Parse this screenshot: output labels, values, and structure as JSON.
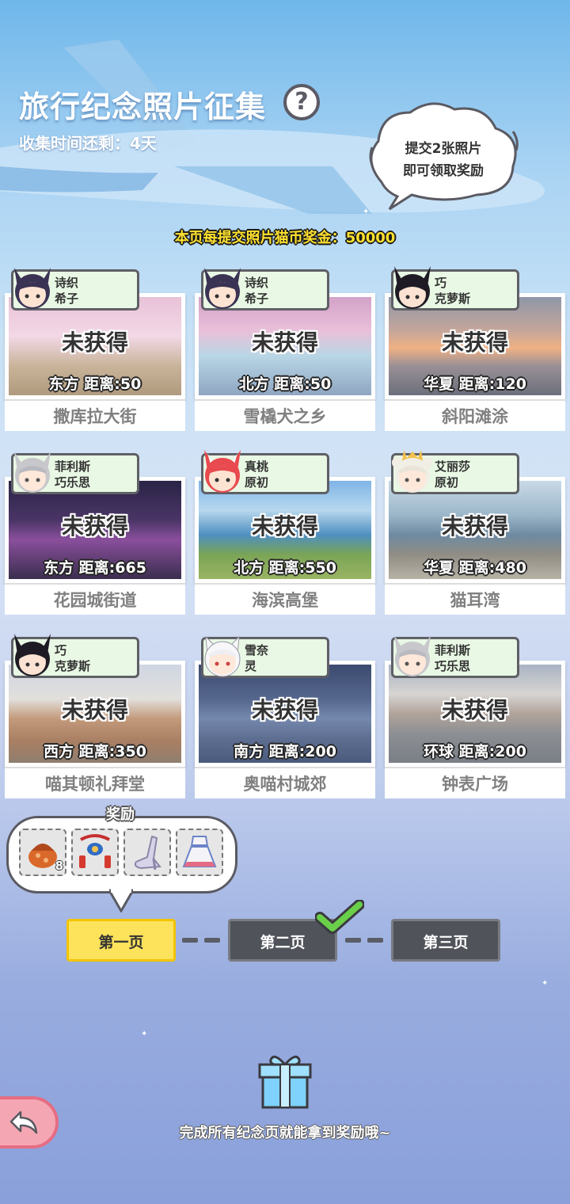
{
  "header": {
    "title": "旅行纪念照片征集",
    "help_symbol": "?",
    "remaining": "收集时间还剩：4天"
  },
  "hint_cloud": {
    "line1": "提交2张照片",
    "line2": "即可领取奖励"
  },
  "bonus_text": "本页每提交照片猫币奖金：50000",
  "cards": [
    {
      "char_line1": "诗织",
      "char_line2": "希子",
      "status": "未获得",
      "distance": "东方  距离:50",
      "place": "撒库拉大街"
    },
    {
      "char_line1": "诗织",
      "char_line2": "希子",
      "status": "未获得",
      "distance": "北方  距离:50",
      "place": "雪橇犬之乡"
    },
    {
      "char_line1": "巧",
      "char_line2": "克萝斯",
      "status": "未获得",
      "distance": "华夏  距离:120",
      "place": "斜阳滩涂"
    },
    {
      "char_line1": "菲利斯",
      "char_line2": "巧乐思",
      "status": "未获得",
      "distance": "东方  距离:665",
      "place": "花园城街道"
    },
    {
      "char_line1": "真桃",
      "char_line2": "原初",
      "status": "未获得",
      "distance": "北方  距离:550",
      "place": "海滨高堡"
    },
    {
      "char_line1": "艾丽莎",
      "char_line2": "原初",
      "status": "未获得",
      "distance": "华夏  距离:480",
      "place": "猫耳湾"
    },
    {
      "char_line1": "巧",
      "char_line2": "克萝斯",
      "status": "未获得",
      "distance": "西方  距离:350",
      "place": "喵其顿礼拜堂"
    },
    {
      "char_line1": "雪奈",
      "char_line2": "灵",
      "status": "未获得",
      "distance": "南方  距离:200",
      "place": "奥喵村城郊"
    },
    {
      "char_line1": "菲利斯",
      "char_line2": "巧乐思",
      "status": "未获得",
      "distance": "环球  距离:200",
      "place": "钟表广场"
    }
  ],
  "reward": {
    "label": "奖励",
    "items": [
      {
        "icon": "cat-food-icon",
        "count": "8"
      },
      {
        "icon": "lantern-decoration-icon",
        "count": ""
      },
      {
        "icon": "high-heel-icon",
        "count": ""
      },
      {
        "icon": "dress-icon",
        "count": ""
      }
    ]
  },
  "pages": [
    {
      "label": "第一页",
      "state": "active"
    },
    {
      "label": "第二页",
      "state": "completed"
    },
    {
      "label": "第三页",
      "state": "inactive"
    }
  ],
  "footer": {
    "text": "完成所有纪念页就能拿到奖励哦~"
  },
  "colors": {
    "active_page": "#fde25b",
    "inactive_page": "#505359",
    "check": "#6ad04a",
    "bonus_text": "#ffe12e",
    "tag_bg": "#e8f8e4"
  }
}
